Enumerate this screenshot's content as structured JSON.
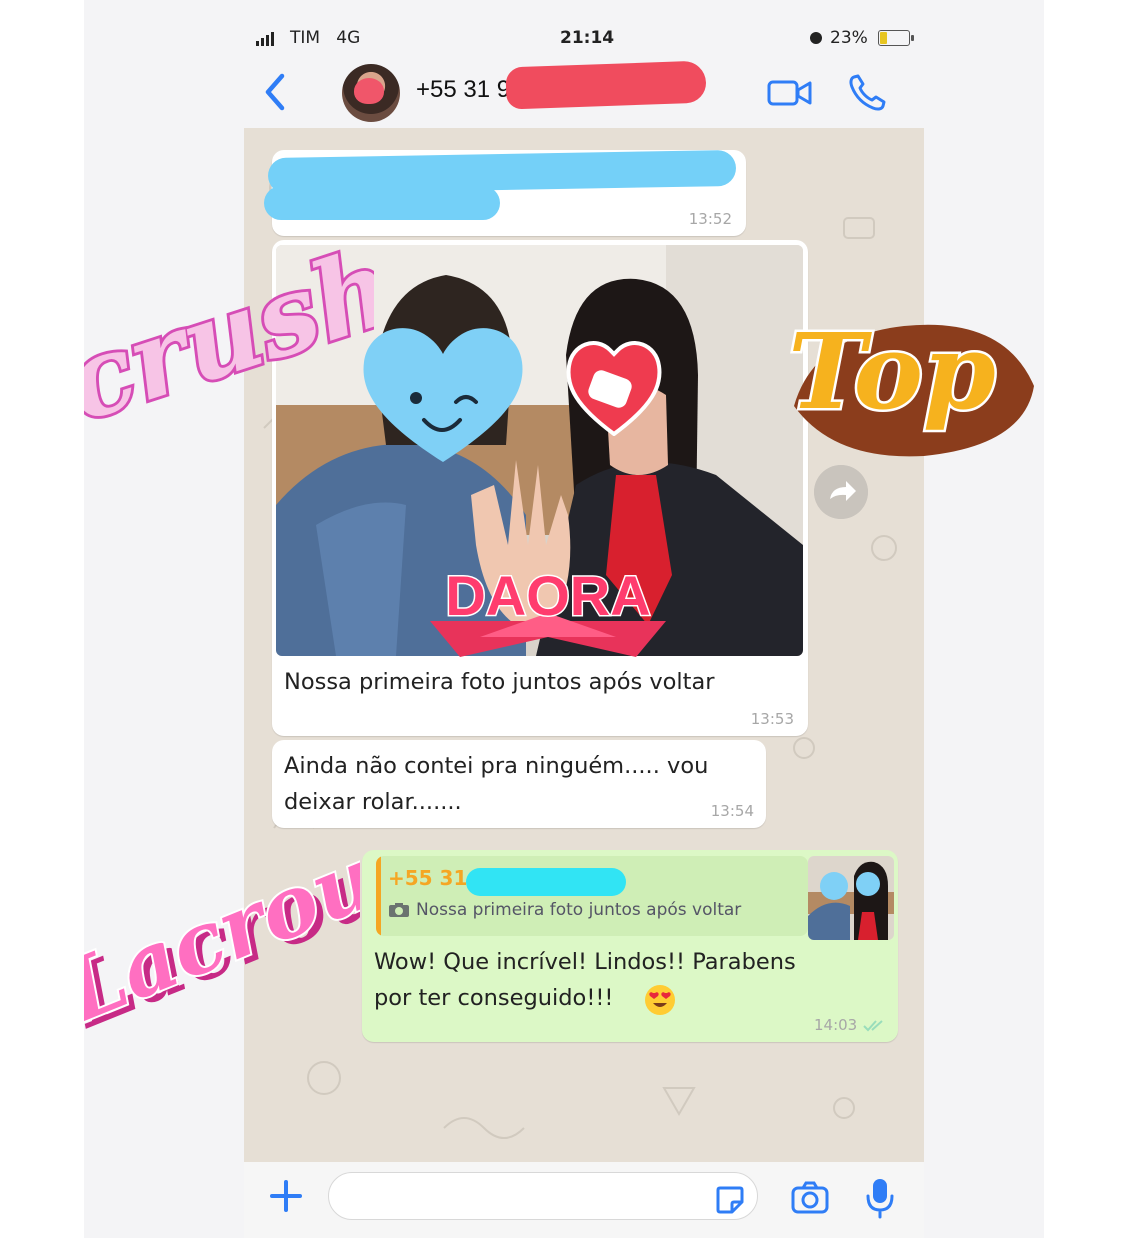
{
  "status_bar": {
    "carrier": "TIM",
    "network": "4G",
    "time": "21:14",
    "battery": "23%",
    "battery_level": 0.23
  },
  "header": {
    "contact_number": "+55 31 98"
  },
  "messages": [
    {
      "id": "m1",
      "direction": "in",
      "time": "13:52",
      "text": ""
    },
    {
      "id": "m2",
      "direction": "in",
      "time": "13:53",
      "caption": "Nossa primeira foto juntos após voltar",
      "media": "photo"
    },
    {
      "id": "m3",
      "direction": "in",
      "time": "13:54",
      "line1": "Ainda não contei pra ninguém..... vou",
      "line2": "deixar rolar......."
    },
    {
      "id": "m4",
      "direction": "out",
      "time": "14:03",
      "reply": {
        "author": "+55 31",
        "quoted": "Nossa primeira foto juntos após voltar"
      },
      "line1": "Wow! Que incrível! Lindos!! Parabens",
      "line2": "por ter conseguido!!!",
      "emoji": "heart-eyes"
    }
  ],
  "stickers": {
    "crush": "crush",
    "top": "Top",
    "daora": "DAORA",
    "lacrou": "Lacrou"
  },
  "colors": {
    "accent": "#2f7df6",
    "chat_bg": "#e6dfd5",
    "outgoing_bubble": "#dcf8c6",
    "incoming_bubble": "#ffffff",
    "redaction_pink": "#f04c5e",
    "redaction_blue": "#74d0f8",
    "redaction_cyan": "#31e4f4"
  },
  "icons": [
    "back-chevron-icon",
    "video-camera-icon",
    "phone-icon",
    "forward-icon",
    "camera-icon",
    "plus-icon",
    "sticker-icon",
    "microphone-icon",
    "double-check-icon"
  ]
}
